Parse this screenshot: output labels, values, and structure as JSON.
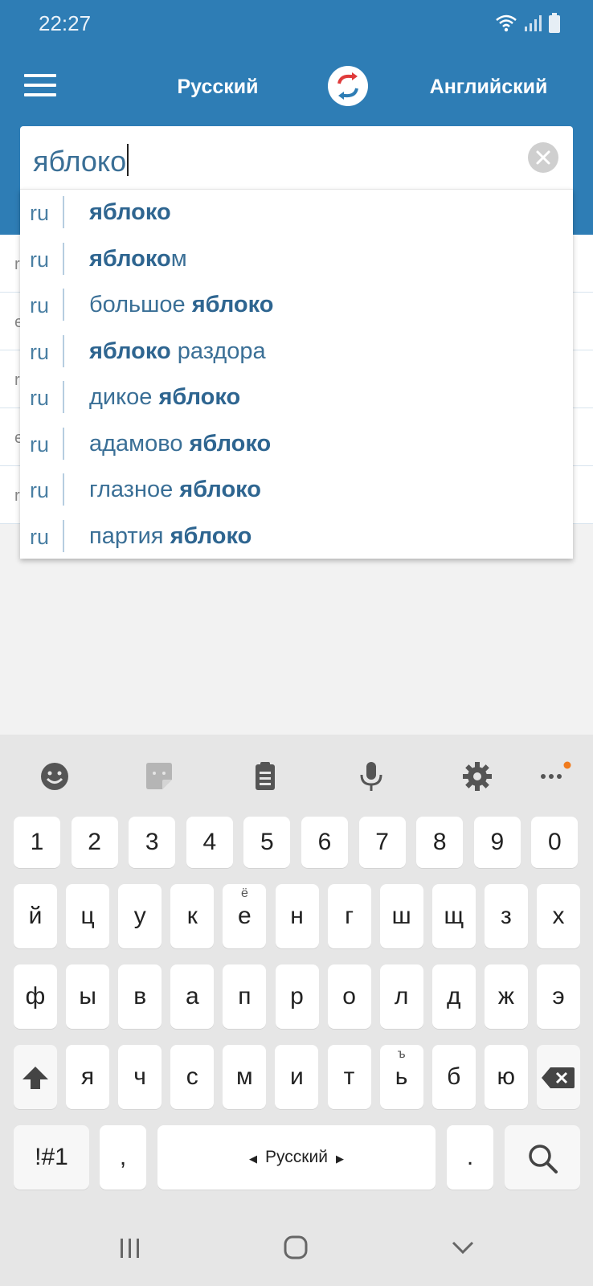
{
  "status": {
    "time": "22:27"
  },
  "toolbar": {
    "source_language": "Русский",
    "target_language": "Английский"
  },
  "search": {
    "value": "яблоко"
  },
  "suggestions": [
    {
      "lang": "ru",
      "pre": "",
      "bold": "яблоко",
      "post": ""
    },
    {
      "lang": "ru",
      "pre": "",
      "bold": "яблоко",
      "post": "м"
    },
    {
      "lang": "ru",
      "pre": "большое ",
      "bold": "яблоко",
      "post": ""
    },
    {
      "lang": "ru",
      "pre": "",
      "bold": "яблоко",
      "post": " раздора"
    },
    {
      "lang": "ru",
      "pre": "дикое ",
      "bold": "яблоко",
      "post": ""
    },
    {
      "lang": "ru",
      "pre": "адамово ",
      "bold": "яблоко",
      "post": ""
    },
    {
      "lang": "ru",
      "pre": "глазное ",
      "bold": "яблоко",
      "post": ""
    },
    {
      "lang": "ru",
      "pre": "партия ",
      "bold": "яблоко",
      "post": ""
    }
  ],
  "background_rows": [
    "r",
    "e",
    "r",
    "e",
    "r"
  ],
  "keyboard": {
    "number_row": [
      "1",
      "2",
      "3",
      "4",
      "5",
      "6",
      "7",
      "8",
      "9",
      "0"
    ],
    "row1": [
      "й",
      "ц",
      "у",
      "к",
      "е",
      "н",
      "г",
      "ш",
      "щ",
      "з",
      "х"
    ],
    "row1_sup": {
      "е": "ё"
    },
    "row2": [
      "ф",
      "ы",
      "в",
      "а",
      "п",
      "р",
      "о",
      "л",
      "д",
      "ж",
      "э"
    ],
    "row3": [
      "я",
      "ч",
      "с",
      "м",
      "и",
      "т",
      "ь",
      "б",
      "ю"
    ],
    "row3_sup": {
      "ь": "ъ"
    },
    "symbols_key": "!#1",
    "comma_key": ",",
    "space_label": "Русский",
    "period_key": "."
  },
  "colors": {
    "header": "#2e7db5",
    "accent_text": "#3a6f96",
    "notification_dot": "#f07b1e"
  }
}
